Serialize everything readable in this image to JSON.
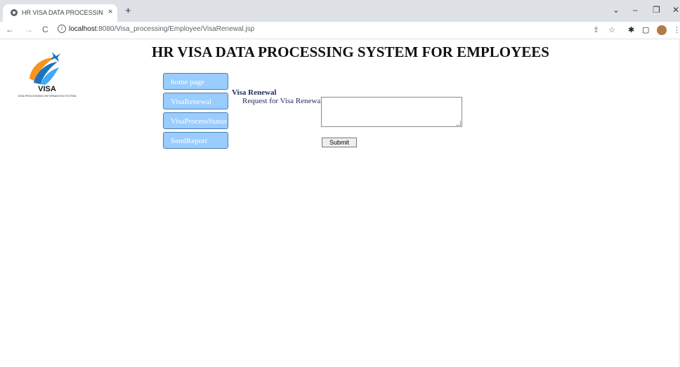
{
  "browser": {
    "tab_title": "HR VISA DATA PROCESSING SYS",
    "tab_close": "×",
    "new_tab": "+",
    "url_host": "localhost",
    "url_rest": ":8080/Visa_processing/Employee/VisaRenewal.jsp",
    "icons": {
      "back": "←",
      "forward": "→",
      "reload": "C",
      "info": "i",
      "share": "⇪",
      "star": "☆",
      "extensions": "✱",
      "sidepanel": "▢",
      "menu": "⋮",
      "collapse": "⌄",
      "minimize": "–",
      "restore": "❐",
      "close": "✕"
    }
  },
  "logo": {
    "name": "VISA",
    "subtitle": "VISA PROCESSING INFORMATION SYSTEM"
  },
  "page": {
    "title": "HR VISA DATA PROCESSING SYSTEM FOR EMPLOYEES"
  },
  "nav": {
    "items": [
      {
        "label": "home page"
      },
      {
        "label": "VisaRenewal"
      },
      {
        "label": "VisaProcessStatus"
      },
      {
        "label": "SendReport"
      }
    ]
  },
  "form": {
    "section_title": "Visa Renewal",
    "field_label": "Request for Visa Renewal :",
    "field_value": "",
    "submit_label": "Submit"
  },
  "colors": {
    "nav_button_bg": "#99ccff",
    "nav_button_border": "#4f7fb3",
    "form_text": "#1f2a5a"
  }
}
